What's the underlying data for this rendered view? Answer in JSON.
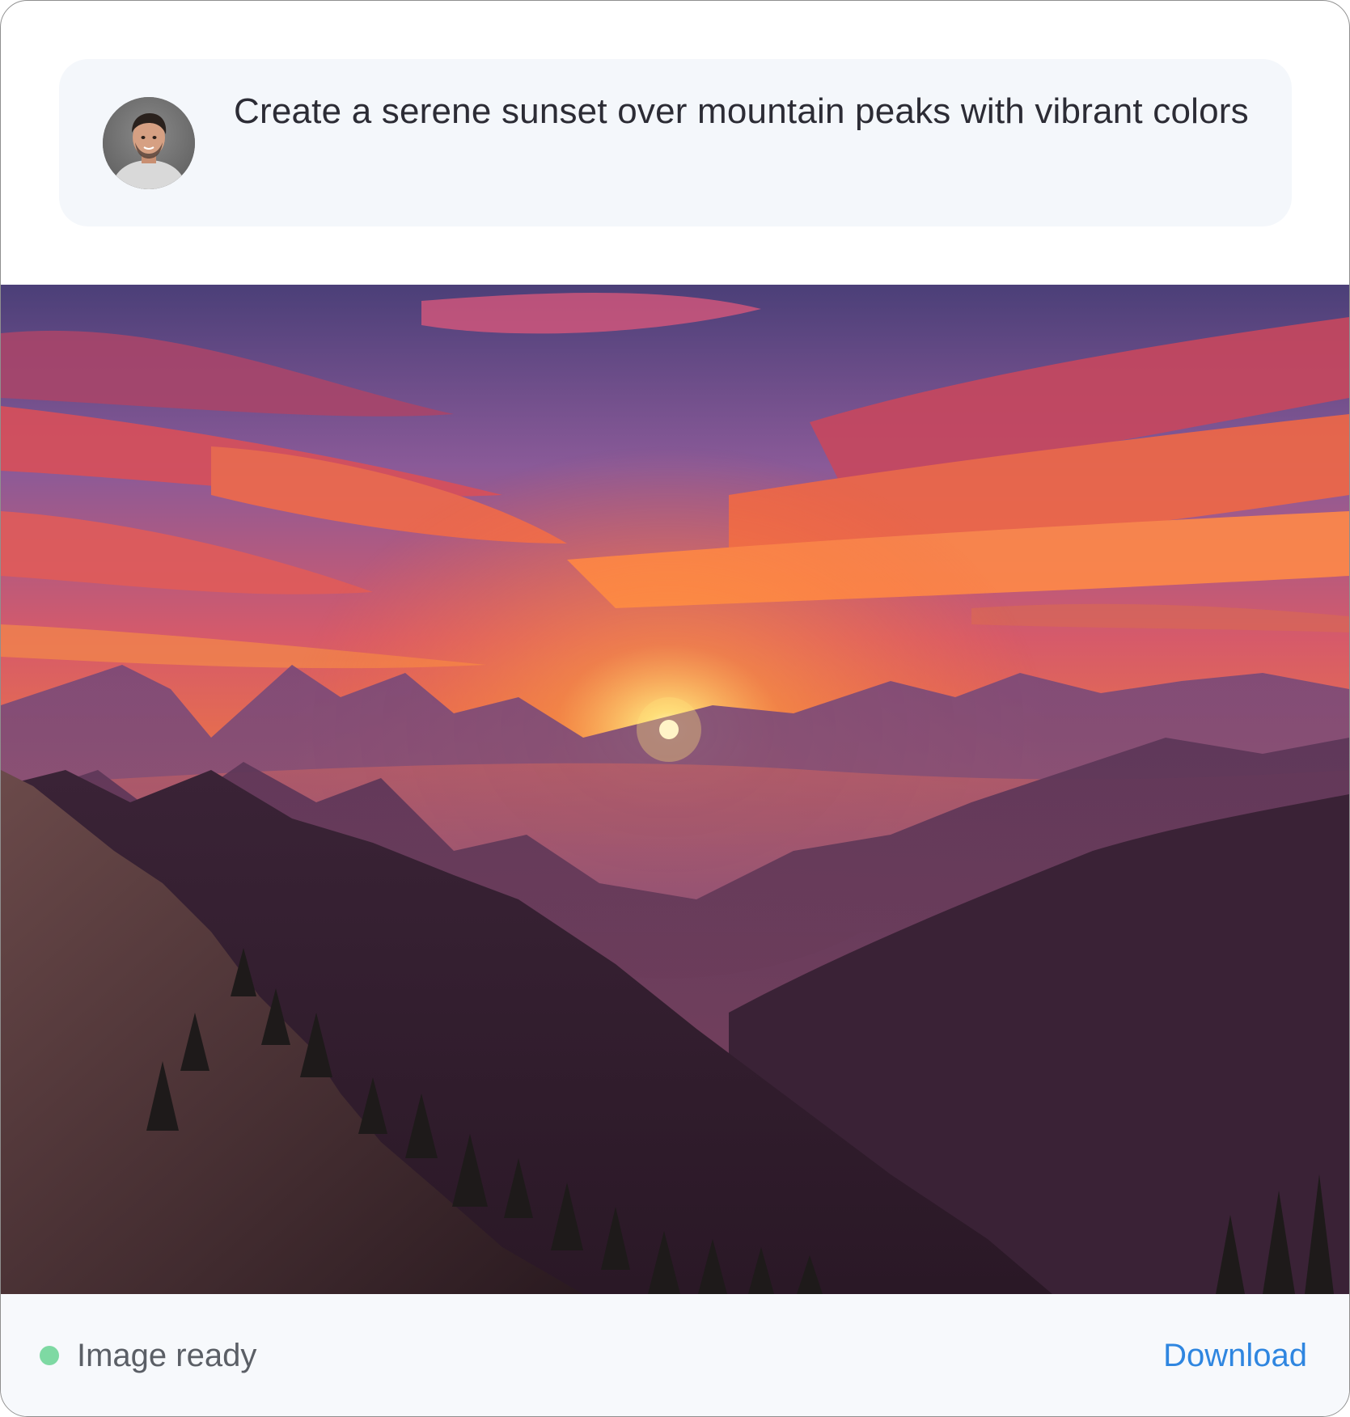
{
  "message": {
    "prompt": "Create a serene sunset over mountain peaks with vibrant colors",
    "avatar_icon": "user-avatar-photo"
  },
  "generated_image": {
    "subject": "sunset-mountain-landscape"
  },
  "footer": {
    "status_label": "Image ready",
    "status_color": "#7ed9a3",
    "download_label": "Download",
    "accent_color": "#2f86e0"
  }
}
